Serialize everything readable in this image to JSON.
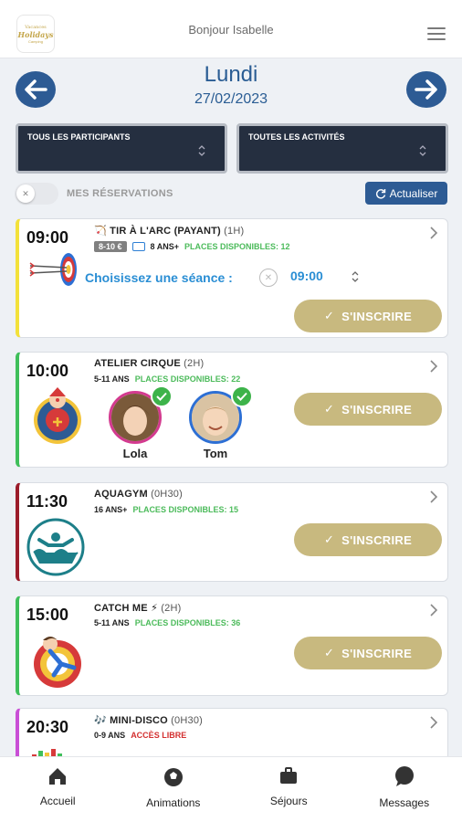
{
  "header": {
    "greeting": "Bonjour Isabelle",
    "logo_text": [
      "Vacances",
      "Holidays",
      "Camping"
    ]
  },
  "day": {
    "title": "Lundi",
    "date": "27/02/2023"
  },
  "filters": {
    "participants": "TOUS LES PARTICIPANTS",
    "activities": "TOUTES LES ACTIVITÉS"
  },
  "reservations_toggle": {
    "label": "MES RÉSERVATIONS",
    "on": false
  },
  "refresh_label": "Actualiser",
  "signup_label": "S'INSCRIRE",
  "activities": [
    {
      "time": "09:00",
      "emoji": "🏹",
      "name": "TIR À L'ARC (PAYANT)",
      "duration": "(1H)",
      "price": "8-10 €",
      "age": "8 ANS+",
      "availability": "PLACES DISPONIBLES: 12",
      "session_label": "Choisissez une séance :",
      "session_time": "09:00",
      "accent": "#f3e13a"
    },
    {
      "time": "10:00",
      "name": "ATELIER CIRQUE",
      "duration": "(2H)",
      "age": "5-11 ANS",
      "availability": "PLACES DISPONIBLES: 22",
      "participants": [
        {
          "name": "Lola",
          "ring_color": "#d33a8f"
        },
        {
          "name": "Tom",
          "ring_color": "#2d6fd4"
        }
      ],
      "accent": "#3fbf5a"
    },
    {
      "time": "11:30",
      "name": "AQUAGYM",
      "duration": "(0H30)",
      "age": "16 ANS+",
      "availability": "PLACES DISPONIBLES: 15",
      "accent": "#9b1c2a"
    },
    {
      "time": "15:00",
      "name": "CATCH ME ⚡",
      "duration": "(2H)",
      "age": "5-11 ANS",
      "availability": "PLACES DISPONIBLES: 36",
      "accent": "#3fbf5a"
    },
    {
      "time": "20:30",
      "emoji": "🎶",
      "name": "MINI-DISCO",
      "duration": "(0H30)",
      "age": "0-9 ANS",
      "availability": "ACCÈS LIBRE",
      "accent": "#c94fd6"
    }
  ],
  "bottom_nav": [
    {
      "label": "Accueil",
      "icon": "home-icon"
    },
    {
      "label": "Animations",
      "icon": "ball-icon"
    },
    {
      "label": "Séjours",
      "icon": "suitcase-icon"
    },
    {
      "label": "Messages",
      "icon": "chat-icon"
    }
  ],
  "colors": {
    "primary": "#2d5b94",
    "gold": "#c8b97f",
    "available": "#4cbb5b",
    "free_access": "#d32f2f"
  }
}
